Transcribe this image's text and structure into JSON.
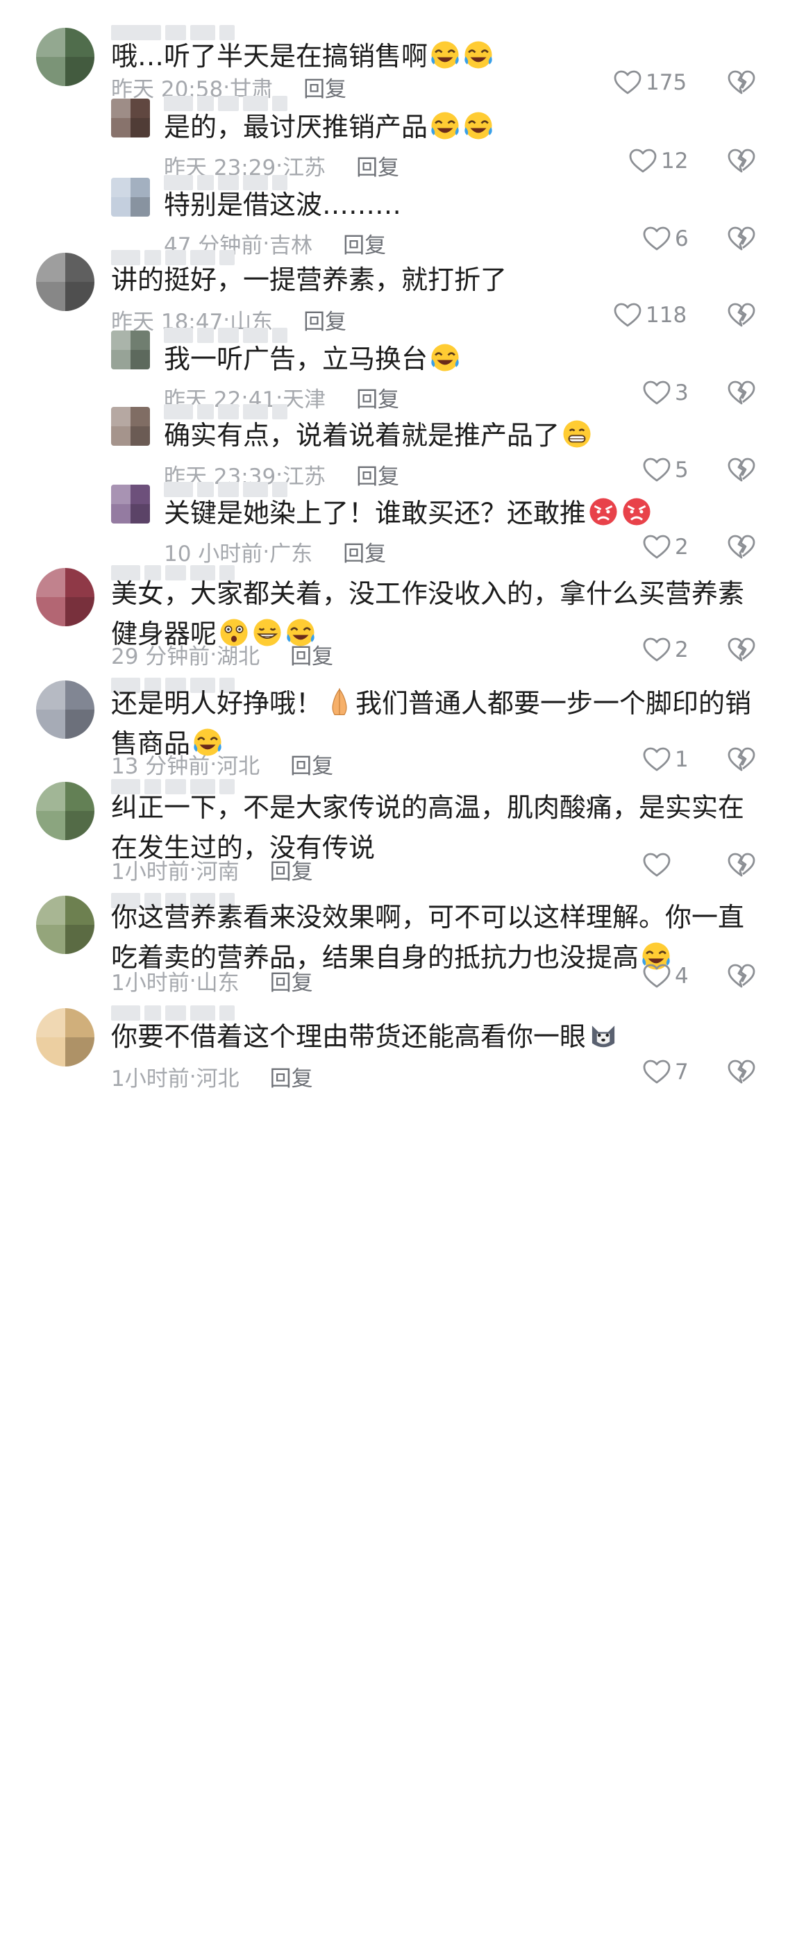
{
  "comments": [
    {
      "level": "top",
      "username": "台灵鸟",
      "text": "哦…听了半天是在搞销售啊",
      "emojis": [
        "laugh-cry-emoji",
        "laugh-cry-emoji"
      ],
      "time": "昨天 20:58",
      "location": "甘肃",
      "reply": "回复",
      "likes": "175",
      "avatar_color": "#5a7a55"
    },
    {
      "level": "reply",
      "username": "关",
      "text": "是的，最讨厌推销产品",
      "emojis": [
        "laugh-cry-emoji",
        "laugh-cry-emoji"
      ],
      "time": "昨天 23:29",
      "location": "江苏",
      "reply": "回复",
      "likes": "12",
      "avatar_color": "#6b5048"
    },
    {
      "level": "reply",
      "username": "",
      "text": "特别是借这波………",
      "emojis": [],
      "time": "47 分钟前",
      "location": "吉林",
      "reply": "回复",
      "likes": "6",
      "avatar_color": "#b6c4d6"
    },
    {
      "level": "top",
      "username": "",
      "text": "讲的挺好，一提营养素，就打折了",
      "emojis": [],
      "time": "昨天 18:47",
      "location": "山东",
      "reply": "回复",
      "likes": "118",
      "avatar_color": "#6a6a6a"
    },
    {
      "level": "reply",
      "username": "",
      "text": "我一听广告，立马换台",
      "emojis": [
        "laugh-cry-emoji"
      ],
      "time": "昨天 22:41",
      "location": "天津",
      "reply": "回复",
      "likes": "3",
      "avatar_color": "#7d8d7d"
    },
    {
      "level": "reply",
      "username": "",
      "text": "确实有点，说着说着就是推产品了",
      "emojis": [
        "grin-emoji"
      ],
      "time": "昨天 23:39",
      "location": "江苏",
      "reply": "回复",
      "likes": "5",
      "avatar_color": "#8f7a70"
    },
    {
      "level": "reply",
      "username": "",
      "text": "关键是她染上了！谁敢买还？还敢推",
      "emojis": [
        "angry-emoji",
        "angry-emoji"
      ],
      "time": "10 小时前",
      "location": "广东",
      "reply": "回复",
      "likes": "2",
      "avatar_color": "#7a5a8a"
    },
    {
      "level": "top",
      "username": "",
      "text": "美女，大家都关着，没工作没收入的，拿什么买营养素健身器呢",
      "emojis": [
        "astonished-emoji",
        "grimace-emoji",
        "laugh-cry-emoji"
      ],
      "time": "29 分钟前",
      "location": "湖北",
      "reply": "回复",
      "likes": "2",
      "avatar_color": "#a04050"
    },
    {
      "level": "top",
      "username": "",
      "text": "还是明人好挣哦！",
      "emojis2_before": [
        "pray-emoji"
      ],
      "text2": "我们普通人都要一步一个脚印的销售商品",
      "emojis": [
        "laugh-cry-emoji"
      ],
      "time": "13 分钟前",
      "location": "河北",
      "reply": "回复",
      "likes": "1",
      "avatar_color": "#9096a4"
    },
    {
      "level": "top",
      "username": "",
      "text": "纠正一下，不是大家传说的高温，肌肉酸痛，是实实在在发生过的，没有传说",
      "emojis": [],
      "time": "1小时前",
      "location": "河南",
      "reply": "回复",
      "likes": "",
      "avatar_color": "#6f8f5f"
    },
    {
      "level": "top",
      "username": "",
      "text": "你这营养素看来没效果啊，可不可以这样理解。你一直吃着卖的营养品，结果自身的抵抗力也没提高",
      "emojis": [
        "laugh-cry-emoji"
      ],
      "time": "1小时前",
      "location": "山东",
      "reply": "回复",
      "likes": "4",
      "avatar_color": "#7a8f5a"
    },
    {
      "level": "top",
      "username": "",
      "text": "你要不借着这个理由带货还能高看你一眼",
      "emojis": [
        "husky-emoji"
      ],
      "time": "1小时前",
      "location": "河北",
      "reply": "回复",
      "likes": "7",
      "avatar_color": "#e8c38a"
    }
  ],
  "colors": {
    "meta": "#a5a8ad",
    "reply": "#6e7177",
    "text": "#1c1c1c",
    "heart": "#8c8f94"
  },
  "icons": {
    "like": "heart-outline-icon",
    "dislike": "broken-heart-icon"
  }
}
